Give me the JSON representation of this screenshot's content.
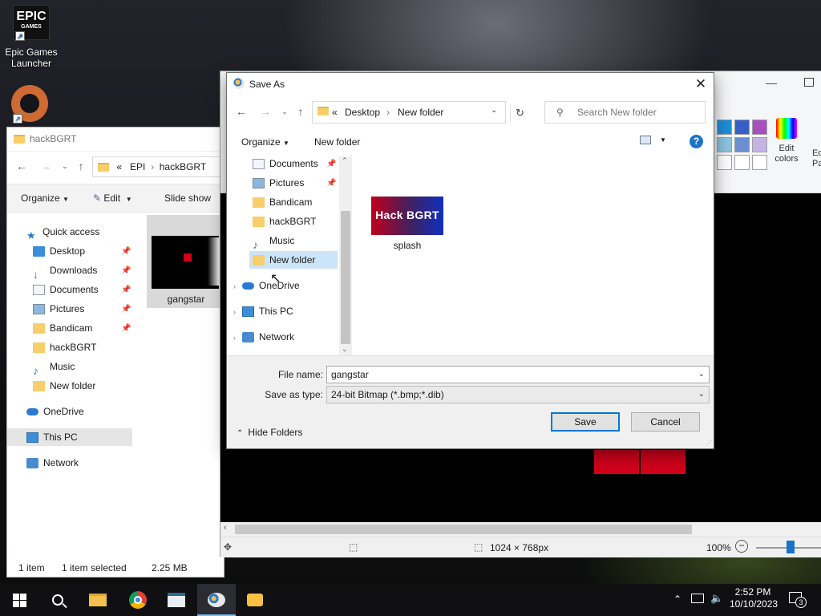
{
  "desktop": {
    "epic_logo_top": "EPIC",
    "epic_logo_bottom": "GAMES",
    "epic_label_1": "Epic Games",
    "epic_label_2": "Launcher"
  },
  "explorer": {
    "title": "hackBGRT",
    "address": {
      "sep": "«",
      "part1": "EPI",
      "arrow": "›",
      "part2": "hackBGRT"
    },
    "commands": {
      "organize": "Organize",
      "edit": "Edit",
      "slideshow": "Slide show"
    },
    "tree": [
      {
        "label": "Quick access"
      },
      {
        "label": "Desktop"
      },
      {
        "label": "Downloads"
      },
      {
        "label": "Documents"
      },
      {
        "label": "Pictures"
      },
      {
        "label": "Bandicam"
      },
      {
        "label": "hackBGRT"
      },
      {
        "label": "Music"
      },
      {
        "label": "New folder"
      },
      {
        "label": "OneDrive"
      },
      {
        "label": "This PC"
      },
      {
        "label": "Network"
      }
    ],
    "file": {
      "name": "gangstar"
    },
    "status": {
      "count": "1 item",
      "selected": "1 item selected",
      "size": "2.25 MB"
    }
  },
  "paint": {
    "edit_colors_1": "Edit",
    "edit_colors_2": "colors",
    "partial_label_1": "Ed",
    "partial_label_2": "Pa",
    "canvas_size": "1024 × 768px",
    "zoom": "100%",
    "swatch_colors": [
      "#1f8ed8",
      "#3a5ec8",
      "#a84fc0",
      "#8cc4e0",
      "#6b8fd0",
      "#c4b4e4",
      "#ffffff",
      "#ffffff",
      "#ffffff"
    ],
    "canvas_red": "#d0021b"
  },
  "saveas": {
    "title": "Save As",
    "close": "✕",
    "address": {
      "sep": "«",
      "part1": "Desktop",
      "arrow": "›",
      "part2": "New folder"
    },
    "search_placeholder": "Search New folder",
    "organize": "Organize",
    "new_folder": "New folder",
    "help": "?",
    "nav": [
      {
        "label": "Documents"
      },
      {
        "label": "Pictures"
      },
      {
        "label": "Bandicam"
      },
      {
        "label": "hackBGRT"
      },
      {
        "label": "Music"
      },
      {
        "label": "New folder"
      },
      {
        "label": "OneDrive"
      },
      {
        "label": "This PC"
      },
      {
        "label": "Network"
      }
    ],
    "file": {
      "thumb_text": "Hack BGRT",
      "name": "splash"
    },
    "file_name_label": "File name:",
    "file_name_value": "gangstar",
    "save_type_label": "Save as type:",
    "save_type_value": "24-bit Bitmap (*.bmp;*.dib)",
    "hide_folders": "Hide Folders",
    "save": "Save",
    "cancel": "Cancel"
  },
  "taskbar": {
    "time": "2:52 PM",
    "date": "10/10/2023",
    "notifications": "3"
  }
}
